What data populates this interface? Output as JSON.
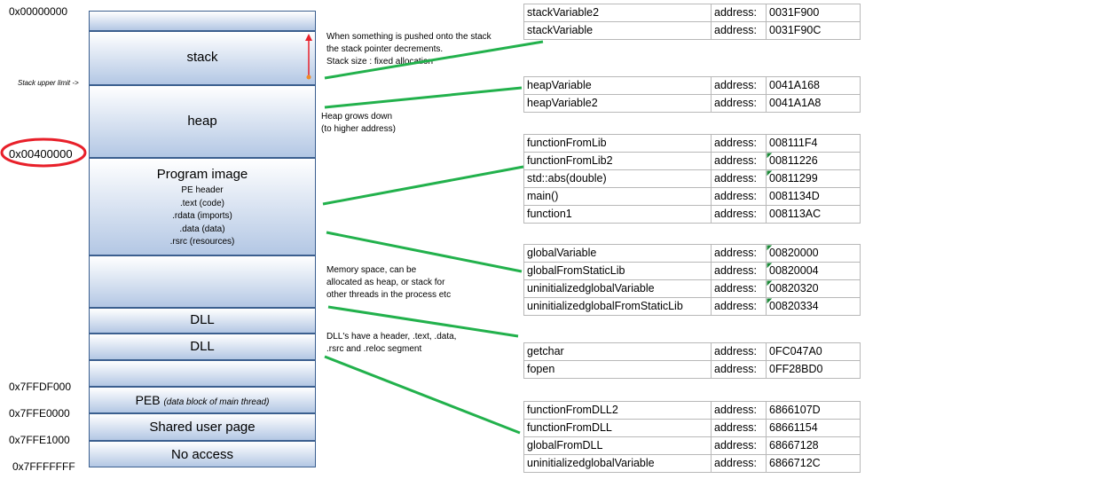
{
  "addresses": {
    "a0": "0x00000000",
    "a_heap": "0x00400000",
    "a_peb": "0x7FFDF000",
    "a_shared": "0x7FFE0000",
    "a_noaccess": "0x7FFE1000",
    "a_end": "0x7FFFFFFF"
  },
  "stack_upper_limit": "Stack upper limit ->",
  "segments": {
    "stack": "stack",
    "heap": "heap",
    "program_image": {
      "title": "Program image",
      "lines": [
        "PE header",
        ".text (code)",
        ".rdata (imports)",
        ".data (data)",
        ".rsrc (resources)"
      ]
    },
    "dll1": "DLL",
    "dll2": "DLL",
    "peb": "PEB",
    "peb_note": "(data block of main thread)",
    "shared": "Shared user page",
    "noaccess": "No access"
  },
  "notes": {
    "stack": [
      "When something is pushed onto the stack",
      "the stack pointer decrements.",
      "Stack size : fixed allocation"
    ],
    "heap": [
      "Heap grows down",
      "(to higher address)"
    ],
    "memory": [
      "Memory space, can be",
      "allocated as heap, or stack for",
      "other threads in the process etc"
    ],
    "dll": [
      "DLL's have a header, .text, .data,",
      ".rsrc and .reloc segment"
    ]
  },
  "tables": [
    {
      "rows": [
        {
          "name": "stackVariable2",
          "label": "address:",
          "value": "0031F900"
        },
        {
          "name": "stackVariable",
          "label": "address:",
          "value": "0031F90C"
        }
      ]
    },
    {
      "rows": [
        {
          "name": "heapVariable",
          "label": "address:",
          "value": "0041A168"
        },
        {
          "name": "heapVariable2",
          "label": "address:",
          "value": "0041A1A8"
        }
      ]
    },
    {
      "rows": [
        {
          "name": "functionFromLib",
          "label": "address:",
          "value": "008111F4"
        },
        {
          "name": "functionFromLib2",
          "label": "address:",
          "value": "00811226"
        },
        {
          "name": "std::abs(double)",
          "label": "address:",
          "value": "00811299"
        },
        {
          "name": "main()",
          "label": "address:",
          "value": "0081134D"
        },
        {
          "name": "function1",
          "label": "address:",
          "value": "008113AC"
        }
      ]
    },
    {
      "rows": [
        {
          "name": "globalVariable",
          "label": "address:",
          "value": "00820000"
        },
        {
          "name": "globalFromStaticLib",
          "label": "address:",
          "value": "00820004"
        },
        {
          "name": "uninitializedglobalVariable",
          "label": "address:",
          "value": "00820320"
        },
        {
          "name": "uninitializedglobalFromStaticLib",
          "label": "address:",
          "value": "00820334"
        }
      ]
    },
    {
      "rows": [
        {
          "name": "getchar",
          "label": "address:",
          "value": "0FC047A0"
        },
        {
          "name": "fopen",
          "label": "address:",
          "value": "0FF28BD0"
        }
      ]
    },
    {
      "rows": [
        {
          "name": "functionFromDLL2",
          "label": "address:",
          "value": "6866107D"
        },
        {
          "name": "functionFromDLL",
          "label": "address:",
          "value": "68661154"
        },
        {
          "name": "globalFromDLL",
          "label": "address:",
          "value": "68667128"
        },
        {
          "name": "uninitializedglobalVariable",
          "label": "address:",
          "value": "6866712C"
        }
      ]
    }
  ],
  "colors": {
    "connector": "#22b14c",
    "highlight_circle": "#e8202a",
    "arrow": "#e8202a",
    "segment_border": "#3b5f8f",
    "segment_fill_bottom": "#b3c7e4"
  }
}
